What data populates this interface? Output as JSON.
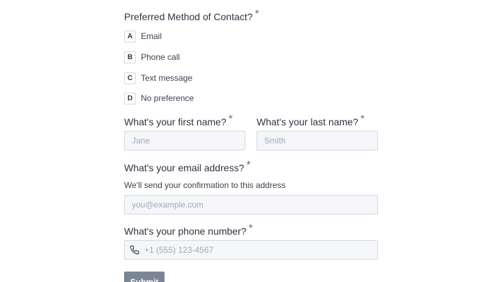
{
  "contact_question": {
    "title": "Preferred Method of Contact?",
    "required_mark": "*",
    "options": [
      {
        "key": "A",
        "label": "Email"
      },
      {
        "key": "B",
        "label": "Phone call"
      },
      {
        "key": "C",
        "label": "Text message"
      },
      {
        "key": "D",
        "label": "No preference"
      }
    ]
  },
  "first_name": {
    "label": "What's your first name?",
    "required_mark": "*",
    "placeholder": "Jane",
    "value": ""
  },
  "last_name": {
    "label": "What's your last name?",
    "required_mark": "*",
    "placeholder": "Smith",
    "value": ""
  },
  "email": {
    "label": "What's your email address?",
    "required_mark": "*",
    "helper": "We'll send your confirmation to this address",
    "placeholder": "you@example.com",
    "value": ""
  },
  "phone": {
    "label": "What's your phone number?",
    "required_mark": "*",
    "icon": "phone-icon",
    "placeholder": "+1 (555) 123-4567",
    "value": ""
  },
  "submit": {
    "label": "Submit"
  },
  "colors": {
    "button_bg": "#7b8594",
    "input_bg": "#f4f6f9",
    "input_border": "#d4d8de",
    "text": "#2c3340",
    "placeholder": "#a3a9b3"
  }
}
